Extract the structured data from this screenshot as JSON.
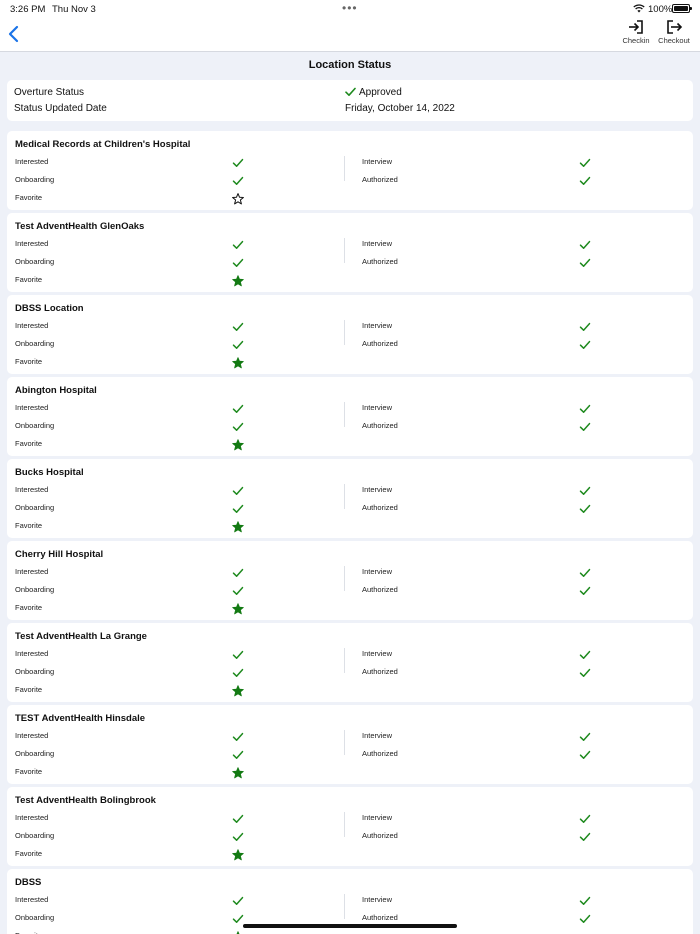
{
  "status_bar": {
    "time": "3:26 PM",
    "date": "Thu Nov 3",
    "battery": "100%"
  },
  "nav": {
    "checkin_label": "Checkin",
    "checkout_label": "Checkout"
  },
  "page_title": "Location Status",
  "overture": {
    "status_label": "Overture Status",
    "status_value": "Approved",
    "date_label": "Status Updated Date",
    "date_value": "Friday, October 14, 2022"
  },
  "field_labels": {
    "interested": "Interested",
    "onboarding": "Onboarding",
    "favorite": "Favorite",
    "interview": "Interview",
    "authorized": "Authorized"
  },
  "colors": {
    "check": "#1e8a1e",
    "star": "#137a13",
    "accent": "#1a73e8"
  },
  "locations": [
    {
      "name": "Medical Records at Children's Hospital",
      "interested": true,
      "onboarding": true,
      "interview": true,
      "authorized": true,
      "favorite": false
    },
    {
      "name": "Test AdventHealth GlenOaks",
      "interested": true,
      "onboarding": true,
      "interview": true,
      "authorized": true,
      "favorite": true
    },
    {
      "name": "DBSS Location",
      "interested": true,
      "onboarding": true,
      "interview": true,
      "authorized": true,
      "favorite": true
    },
    {
      "name": "Abington Hospital",
      "interested": true,
      "onboarding": true,
      "interview": true,
      "authorized": true,
      "favorite": true
    },
    {
      "name": "Bucks Hospital",
      "interested": true,
      "onboarding": true,
      "interview": true,
      "authorized": true,
      "favorite": true
    },
    {
      "name": "Cherry Hill Hospital",
      "interested": true,
      "onboarding": true,
      "interview": true,
      "authorized": true,
      "favorite": true
    },
    {
      "name": "Test AdventHealth La Grange",
      "interested": true,
      "onboarding": true,
      "interview": true,
      "authorized": true,
      "favorite": true
    },
    {
      "name": "TEST AdventHealth Hinsdale",
      "interested": true,
      "onboarding": true,
      "interview": true,
      "authorized": true,
      "favorite": true
    },
    {
      "name": "Test AdventHealth Bolingbrook",
      "interested": true,
      "onboarding": true,
      "interview": true,
      "authorized": true,
      "favorite": true
    },
    {
      "name": "DBSS",
      "interested": true,
      "onboarding": true,
      "interview": true,
      "authorized": true,
      "favorite": true
    }
  ]
}
